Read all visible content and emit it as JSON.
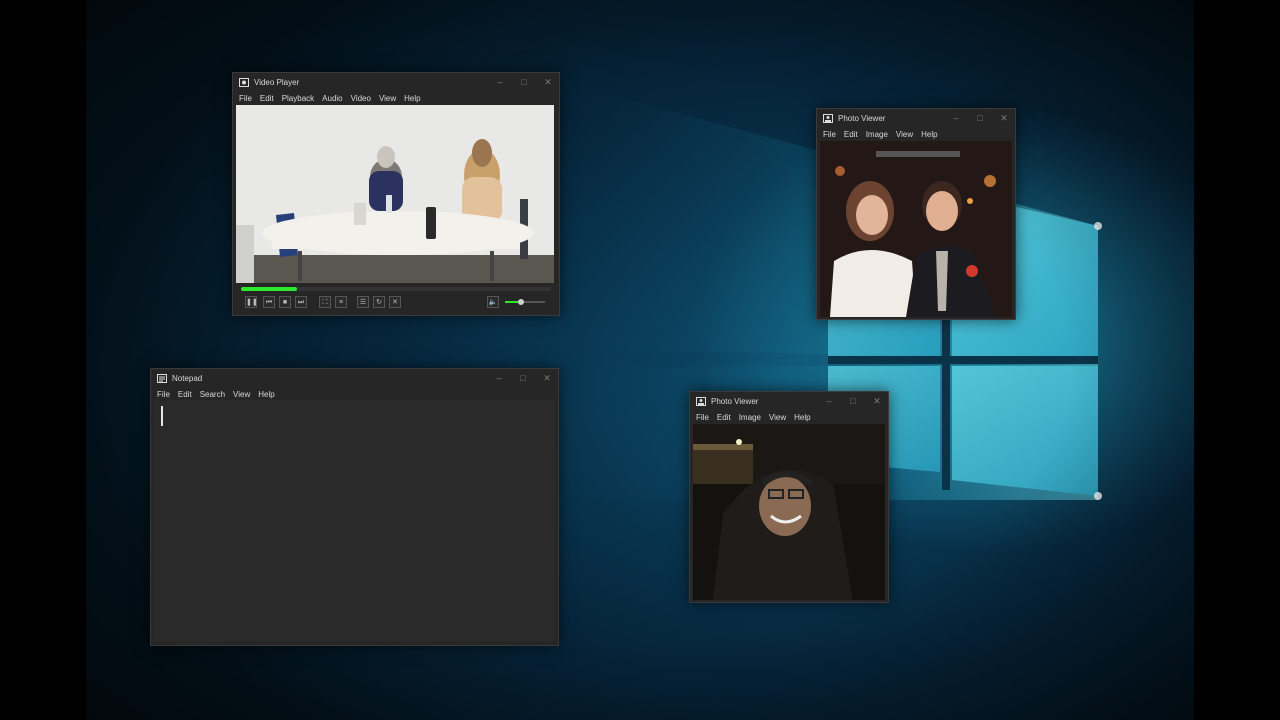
{
  "video_player": {
    "title": "Video Player",
    "icon": "camera-icon",
    "menu": [
      "File",
      "Edit",
      "Playback",
      "Audio",
      "Video",
      "View",
      "Help"
    ],
    "progress": 0.18,
    "volume": 0.4
  },
  "photo_viewer_1": {
    "title": "Photo Viewer",
    "icon": "photo-icon",
    "menu": [
      "File",
      "Edit",
      "Image",
      "View",
      "Help"
    ]
  },
  "photo_viewer_2": {
    "title": "Photo Viewer",
    "icon": "photo-icon",
    "menu": [
      "File",
      "Edit",
      "Image",
      "View",
      "Help"
    ]
  },
  "notepad": {
    "title": "Notepad",
    "icon": "notepad-icon",
    "menu": [
      "File",
      "Edit",
      "Search",
      "View",
      "Help"
    ],
    "content": ""
  },
  "window_controls": {
    "minimize": "–",
    "maximize": "□",
    "close": "✕"
  },
  "colors": {
    "accent_green": "#2ee82e",
    "window_bg": "#262626",
    "desktop_glow": "#3fd7e8"
  }
}
